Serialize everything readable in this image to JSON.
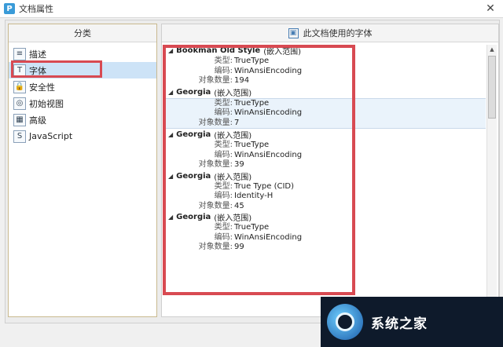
{
  "window": {
    "app_icon": "P",
    "title": "文档属性",
    "close_symbol": "✕"
  },
  "left": {
    "header": "分类",
    "items": [
      {
        "icon": "description-icon",
        "glyph": "≡",
        "label": "描述"
      },
      {
        "icon": "font-icon",
        "glyph": "T",
        "label": "字体"
      },
      {
        "icon": "lock-icon",
        "glyph": "🔒",
        "label": "安全性"
      },
      {
        "icon": "initial-view-icon",
        "glyph": "◎",
        "label": "初始视图"
      },
      {
        "icon": "advanced-icon",
        "glyph": "▦",
        "label": "高级"
      },
      {
        "icon": "javascript-icon",
        "glyph": "S",
        "label": "JavaScript"
      }
    ],
    "selected_index": 1
  },
  "right": {
    "header": "此文档使用的字体",
    "labels": {
      "type": "类型:",
      "encoding": "编码:",
      "count": "对象数量:"
    },
    "fonts": [
      {
        "name": "Bookman Old Style",
        "suffix": "(嵌入范围)",
        "type": "TrueType",
        "encoding": "WinAnsiEncoding",
        "count": "194"
      },
      {
        "name": "Georgia",
        "suffix": "(嵌入范围)",
        "type": "TrueType",
        "encoding": "WinAnsiEncoding",
        "count": "7"
      },
      {
        "name": "Georgia",
        "suffix": "(嵌入范围)",
        "type": "TrueType",
        "encoding": "WinAnsiEncoding",
        "count": "39"
      },
      {
        "name": "Georgia",
        "suffix": "(嵌入范围)",
        "type": "True Type (CID)",
        "encoding": "Identity-H",
        "count": "45"
      },
      {
        "name": "Georgia",
        "suffix": "(嵌入范围)",
        "type": "TrueType",
        "encoding": "WinAnsiEncoding",
        "count": "99"
      }
    ]
  },
  "watermark": {
    "text": "系统之家"
  },
  "colors": {
    "highlight": "#d84a52",
    "selection": "#cde3f7"
  }
}
